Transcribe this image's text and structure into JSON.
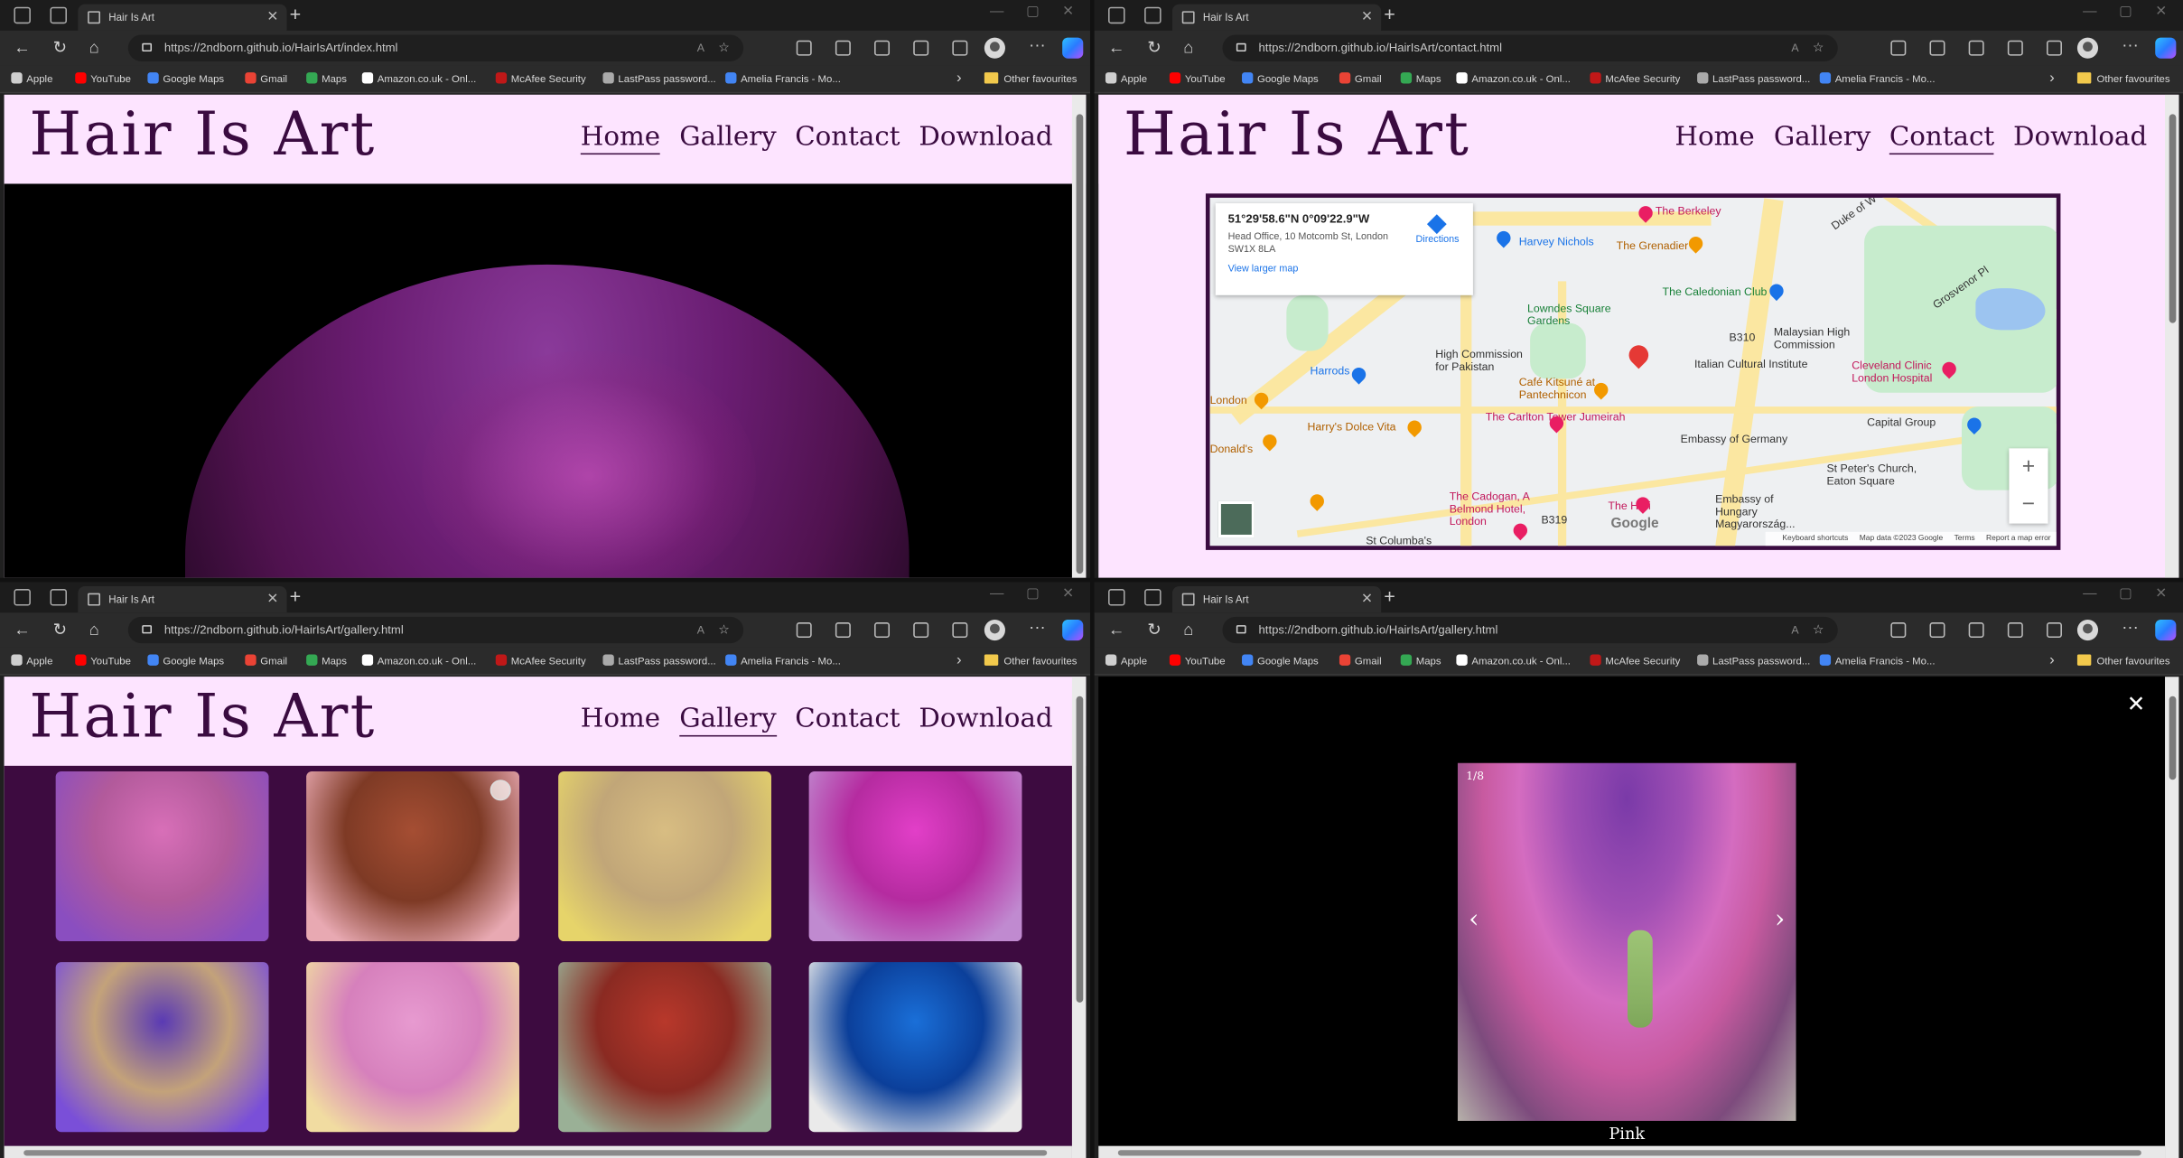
{
  "windows": [
    {
      "id": "home",
      "tab_title": "Hair Is Art",
      "url": "https://2ndborn.github.io/HairIsArt/index.html",
      "active_nav": "Home"
    },
    {
      "id": "contact",
      "tab_title": "Hair Is Art",
      "url": "https://2ndborn.github.io/HairIsArt/contact.html",
      "active_nav": "Contact"
    },
    {
      "id": "gallery",
      "tab_title": "Hair Is Art",
      "url": "https://2ndborn.github.io/HairIsArt/gallery.html",
      "active_nav": "Gallery"
    },
    {
      "id": "lightbox",
      "tab_title": "Hair Is Art",
      "url": "https://2ndborn.github.io/HairIsArt/gallery.html",
      "active_nav": ""
    }
  ],
  "bookmarks": [
    "Apple",
    "YouTube",
    "Google Maps",
    "Gmail",
    "Maps",
    "Amazon.co.uk - Onl...",
    "McAfee Security",
    "LastPass password...",
    "Amelia Francis - Mo..."
  ],
  "bookmark_colors": [
    "#cfcfcf",
    "#ff0000",
    "#4285f4",
    "#ea4335",
    "#34a853",
    "#ffffff",
    "#c01818",
    "#aaaaaa",
    "#4285f4"
  ],
  "other_favourites": "Other favourites",
  "site": {
    "logo": "Hair Is Art",
    "nav": [
      "Home",
      "Gallery",
      "Contact",
      "Download"
    ]
  },
  "map": {
    "coordinates": "51°29'58.6\"N 0°09'22.9\"W",
    "address": "Head Office, 10 Motcomb St, London SW1X 8LA",
    "view_larger": "View larger map",
    "directions": "Directions",
    "labels": [
      {
        "text": "The Berkeley",
        "cls": "pink"
      },
      {
        "text": "Harvey Nichols",
        "cls": "blue"
      },
      {
        "text": "The Grenadier",
        "cls": "orange"
      },
      {
        "text": "The Caledonian Club",
        "cls": "green"
      },
      {
        "text": "Lowndes Square Gardens",
        "cls": "green"
      },
      {
        "text": "Malaysian High Commission",
        "cls": ""
      },
      {
        "text": "Harrods",
        "cls": "blue"
      },
      {
        "text": "High Commission for Pakistan",
        "cls": ""
      },
      {
        "text": "Italian Cultural Institute",
        "cls": ""
      },
      {
        "text": "Cleveland Clinic London Hospital",
        "cls": "pink"
      },
      {
        "text": "Café Kitsuné at Pantechnicon",
        "cls": "orange"
      },
      {
        "text": "London",
        "cls": "orange"
      },
      {
        "text": "Harry's Dolce Vita",
        "cls": "orange"
      },
      {
        "text": "The Carlton Tower Jumeirah",
        "cls": "pink"
      },
      {
        "text": "Capital Group",
        "cls": ""
      },
      {
        "text": "Embassy of Germany",
        "cls": ""
      },
      {
        "text": "St Peter's Church, Eaton Square",
        "cls": ""
      },
      {
        "text": "Donald's",
        "cls": "orange"
      },
      {
        "text": "The Cadogan, A Belmond Hotel, London",
        "cls": "pink"
      },
      {
        "text": "The Hari",
        "cls": "pink"
      },
      {
        "text": "Embassy of Hungary Magyarország...",
        "cls": ""
      },
      {
        "text": "St Columba's",
        "cls": ""
      },
      {
        "text": "B319",
        "cls": ""
      },
      {
        "text": "B310",
        "cls": ""
      },
      {
        "text": "Grosvenor Pl",
        "cls": ""
      },
      {
        "text": "Duke of W",
        "cls": ""
      }
    ],
    "zoom_in": "+",
    "zoom_out": "−",
    "google": "Google",
    "attribution": [
      "Keyboard shortcuts",
      "Map data ©2023 Google",
      "Terms",
      "Report a map error"
    ]
  },
  "gallery": {
    "images": [
      {
        "alt": "purple pink bob with green streak",
        "colors": [
          "#8a4ec0",
          "#d86fb8",
          "#b25a9b"
        ]
      },
      {
        "alt": "auburn wavy bob",
        "colors": [
          "#e8a9b2",
          "#a54e33",
          "#7e3a25"
        ]
      },
      {
        "alt": "blonde straight hair",
        "colors": [
          "#e6d46a",
          "#d8bd82",
          "#c1a678"
        ]
      },
      {
        "alt": "magenta long hair with hand",
        "colors": [
          "#c08ad0",
          "#e23fc8",
          "#b52ba0"
        ]
      },
      {
        "alt": "purple blue bob",
        "colors": [
          "#7a4fd8",
          "#5a3ab4",
          "#c3a27a"
        ]
      },
      {
        "alt": "pastel pink curls",
        "colors": [
          "#f1dca1",
          "#e79ad0",
          "#d680bc"
        ]
      },
      {
        "alt": "red wavy hair",
        "colors": [
          "#9ab096",
          "#b8382b",
          "#8a2a22"
        ]
      },
      {
        "alt": "electric blue hair",
        "colors": [
          "#eaeaea",
          "#1a6fd8",
          "#0b3f9a"
        ]
      }
    ]
  },
  "lightbox": {
    "counter": "1/8",
    "caption": "Pink",
    "prev": "‹",
    "next": "›",
    "close": "✕"
  }
}
